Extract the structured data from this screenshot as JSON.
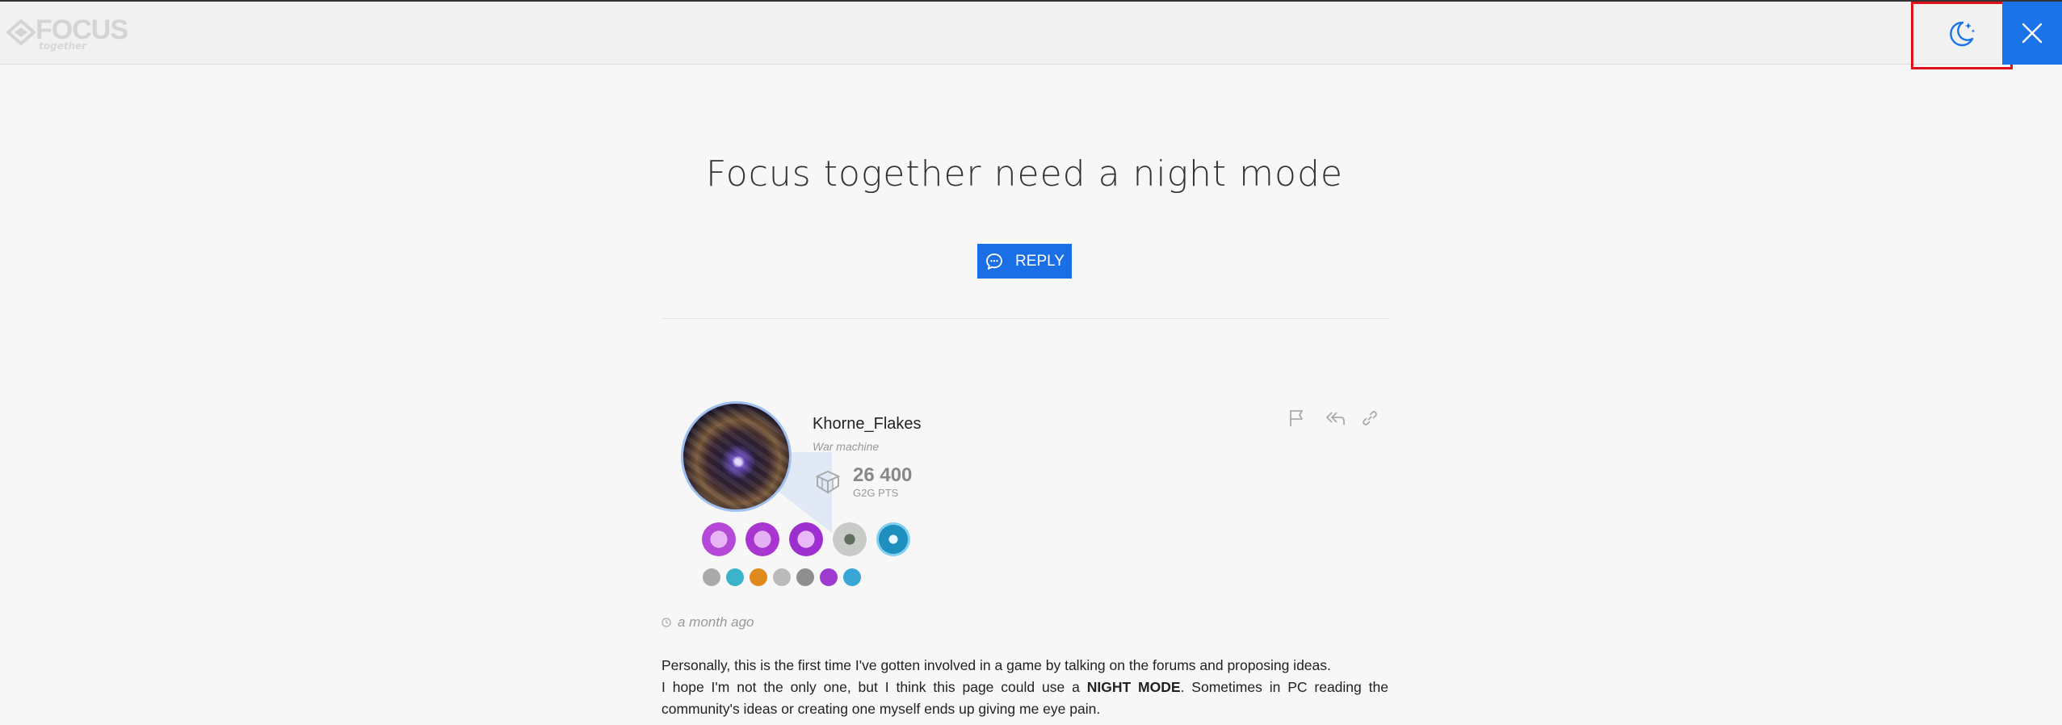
{
  "header": {
    "logo_text": "FOCUS",
    "logo_sub": "together",
    "night_mode_icon": "moon-stars-icon",
    "close_icon": "close-icon"
  },
  "thread": {
    "title": "Focus together need a night mode",
    "reply_label": "REPLY"
  },
  "post": {
    "author": "Khorne_Flakes",
    "rank": "War machine",
    "points": "26 400",
    "points_label": "G2G PTS",
    "timestamp": "a month ago",
    "line1": "Personally, this is the first time I've gotten involved in a game by talking on the forums and proposing ideas.",
    "line2_pre": "I hope I'm not the only one, but I think this page could use a ",
    "line2_bold": "NIGHT MODE",
    "line2_post": ". Sometimes in PC reading the community's ideas or creating one myself ends up giving me eye pain.",
    "actions": [
      "flag-icon",
      "quote-reply-icon",
      "link-icon"
    ]
  },
  "colors": {
    "accent": "#1a73e8",
    "highlight_box": "#e0101a",
    "background": "#f7f7f7"
  }
}
